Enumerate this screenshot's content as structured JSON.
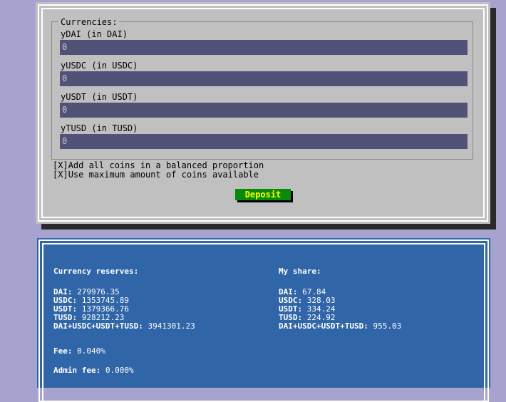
{
  "deposit_form": {
    "legend": "Currencies:",
    "fields": [
      {
        "label": "yDAI (in DAI)",
        "value": "0"
      },
      {
        "label": "yUSDC (in USDC)",
        "value": "0"
      },
      {
        "label": "yUSDT (in USDT)",
        "value": "0"
      },
      {
        "label": "yTUSD (in TUSD)",
        "value": "0"
      }
    ],
    "options": [
      {
        "mark": "[X]",
        "label": "Add all coins in a balanced proportion"
      },
      {
        "mark": "[X]",
        "label": "Use maximum amount of coins available"
      }
    ],
    "deposit_label": "Deposit"
  },
  "reserves": {
    "title": "Currency reserves:",
    "rows": [
      {
        "key": "DAI:",
        "value": "279976.35"
      },
      {
        "key": "USDC:",
        "value": "1353745.89"
      },
      {
        "key": "USDT:",
        "value": "1379366.76"
      },
      {
        "key": "TUSD:",
        "value": "928212.23"
      },
      {
        "key": "DAI+USDC+USDT+TUSD:",
        "value": "3941301.23"
      }
    ],
    "fee_key": "Fee:",
    "fee_value": "0.040%",
    "admin_fee_key": "Admin fee:",
    "admin_fee_value": "0.000%"
  },
  "my_share": {
    "title": "My share:",
    "rows": [
      {
        "key": "DAI:",
        "value": "67.84"
      },
      {
        "key": "USDC:",
        "value": "328.03"
      },
      {
        "key": "USDT:",
        "value": "334.24"
      },
      {
        "key": "TUSD:",
        "value": "224.92"
      },
      {
        "key": "DAI+USDC+USDT+TUSD:",
        "value": "955.03"
      }
    ]
  }
}
